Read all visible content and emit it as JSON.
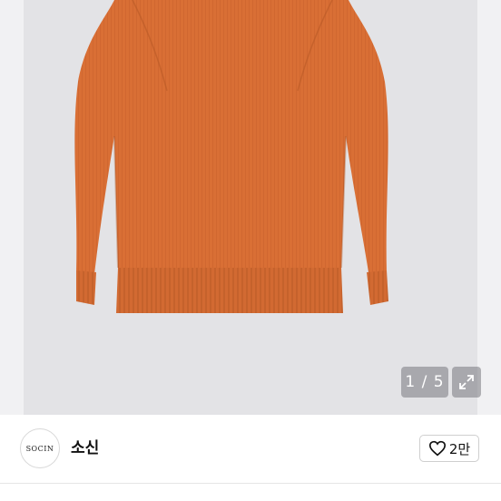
{
  "gallery": {
    "counter": "1 / 5",
    "expand_icon": "expand-arrows-icon",
    "product_color": "#d96f35"
  },
  "seller": {
    "avatar_text": "SOCIN",
    "name": "소신"
  },
  "like": {
    "icon": "heart-outline-icon",
    "count": "2만"
  }
}
